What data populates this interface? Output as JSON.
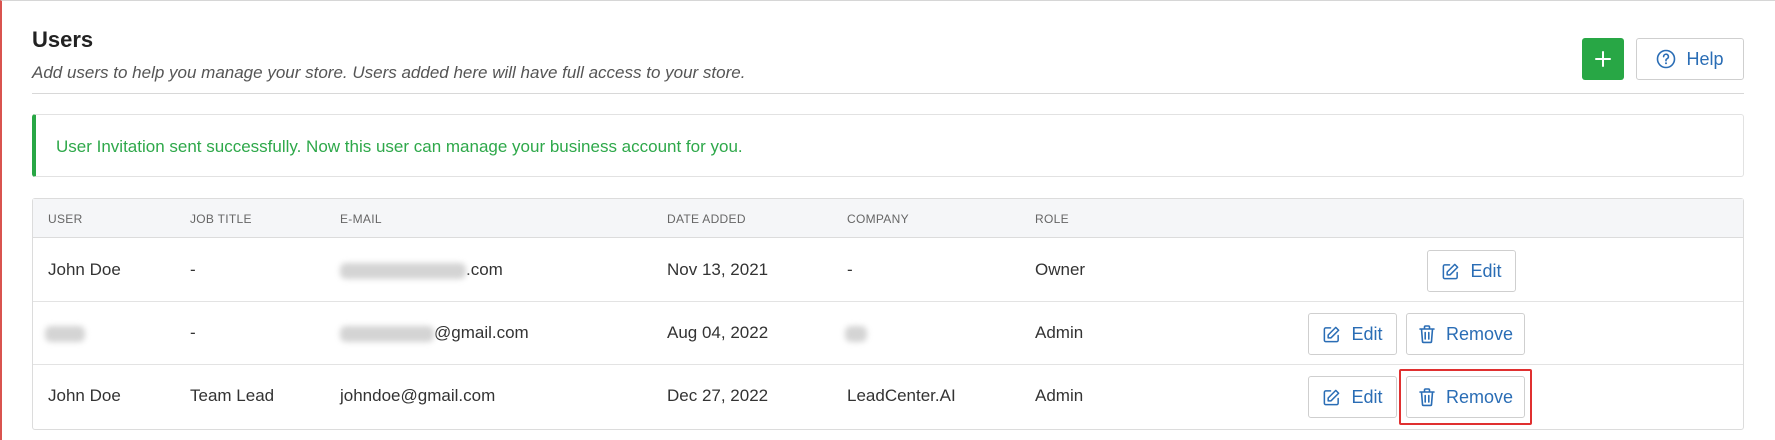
{
  "header": {
    "title": "Users",
    "subtitle": "Add users to help you manage your store. Users added here will have full access to your store.",
    "help_label": "Help"
  },
  "alert": {
    "message": "User Invitation sent successfully. Now this user can manage your business account for you."
  },
  "table": {
    "columns": [
      "USER",
      "JOB TITLE",
      "E-MAIL",
      "DATE ADDED",
      "COMPANY",
      "ROLE"
    ],
    "rows": [
      {
        "user": "John Doe",
        "job_title": "-",
        "email_suffix": ".com",
        "date_added": "Nov 13, 2021",
        "company": "-",
        "role": "Owner",
        "edit_label": "Edit"
      },
      {
        "user": "",
        "job_title": "-",
        "email_suffix": "@gmail.com",
        "date_added": "Aug 04, 2022",
        "company": "",
        "role": "Admin",
        "edit_label": "Edit",
        "remove_label": "Remove"
      },
      {
        "user": "John Doe",
        "job_title": "Team Lead",
        "email": "johndoe@gmail.com",
        "date_added": "Dec 27, 2022",
        "company": "LeadCenter.AI",
        "role": "Admin",
        "edit_label": "Edit",
        "remove_label": "Remove"
      }
    ]
  },
  "colors": {
    "accent_green": "#28a745",
    "link_blue": "#2a6db5",
    "highlight_red": "#e03030"
  }
}
